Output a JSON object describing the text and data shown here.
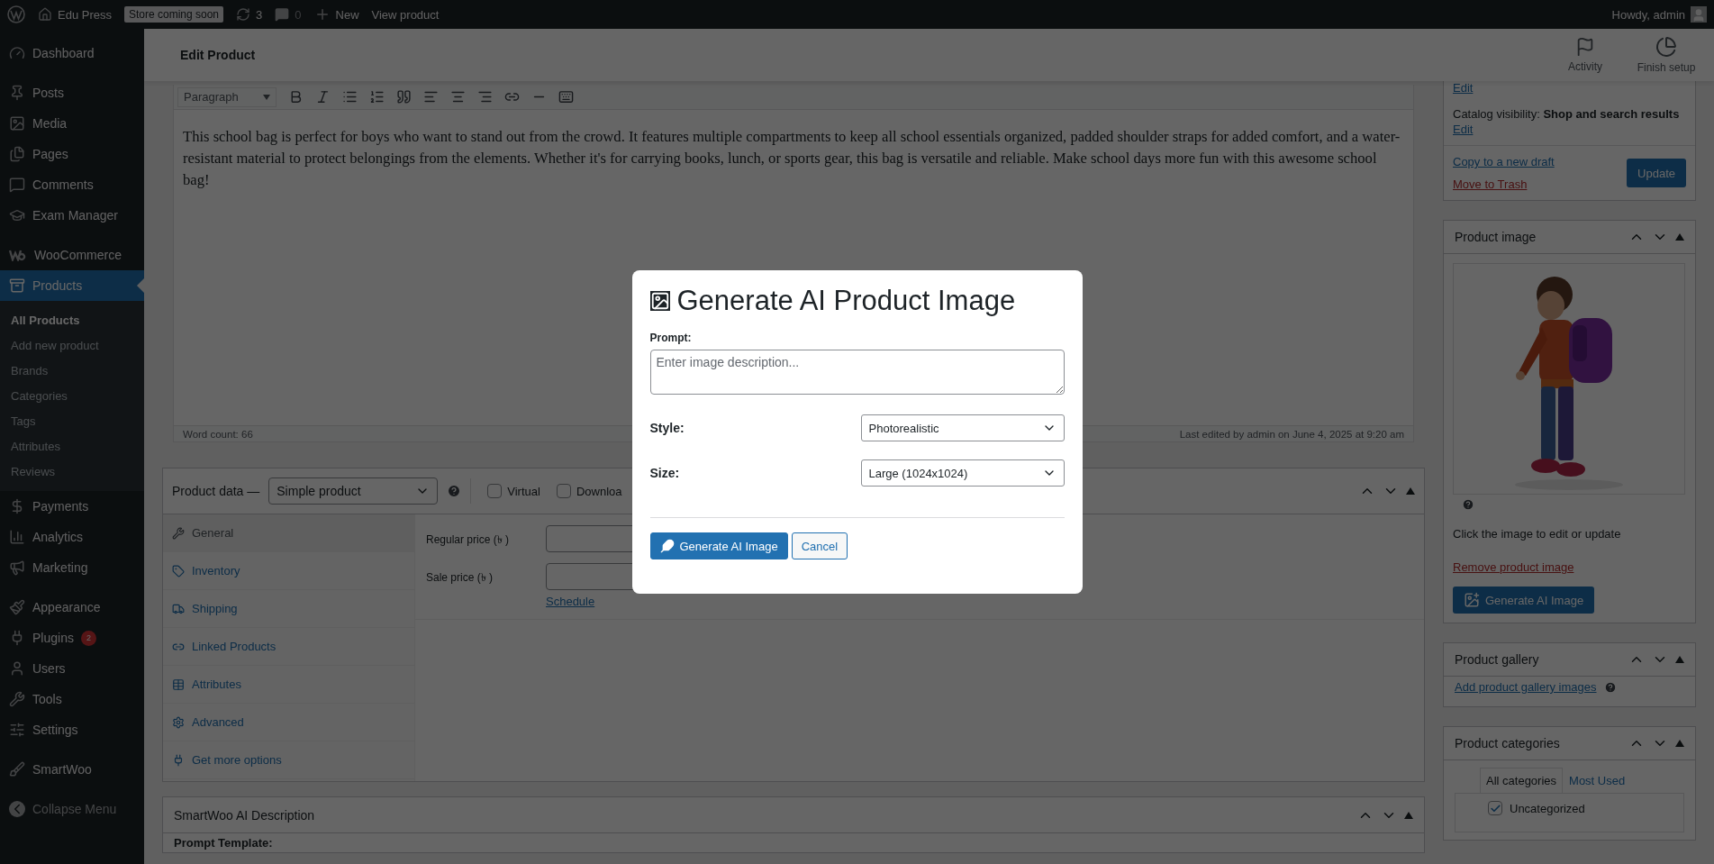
{
  "admin_bar": {
    "site": "Edu Press",
    "badge": "Store coming soon",
    "updates": "3",
    "comments": "0",
    "new": "New",
    "view": "View product",
    "greeting": "Howdy, admin"
  },
  "sidebar": {
    "groups": [
      [
        {
          "label": "Dashboard",
          "selected": false
        }
      ],
      [
        {
          "label": "Posts",
          "selected": false
        },
        {
          "label": "Media",
          "selected": false
        },
        {
          "label": "Pages",
          "selected": false
        },
        {
          "label": "Comments",
          "selected": false
        },
        {
          "label": "Exam Manager",
          "selected": false
        }
      ],
      [
        {
          "label": "WooCommerce",
          "selected": false
        },
        {
          "label": "Products",
          "selected": true,
          "children": [
            {
              "label": "All Products",
              "selected": true
            },
            {
              "label": "Add new product",
              "selected": false
            },
            {
              "label": "Brands",
              "selected": false
            },
            {
              "label": "Categories",
              "selected": false
            },
            {
              "label": "Tags",
              "selected": false
            },
            {
              "label": "Attributes",
              "selected": false
            },
            {
              "label": "Reviews",
              "selected": false
            }
          ]
        },
        {
          "label": "Payments",
          "selected": false
        },
        {
          "label": "Analytics",
          "selected": false
        },
        {
          "label": "Marketing",
          "selected": false
        }
      ],
      [
        {
          "label": "Appearance",
          "selected": false
        },
        {
          "label": "Plugins",
          "selected": false,
          "badge": "2"
        },
        {
          "label": "Users",
          "selected": false
        },
        {
          "label": "Tools",
          "selected": false
        },
        {
          "label": "Settings",
          "selected": false
        }
      ],
      [
        {
          "label": "SmartWoo",
          "selected": false
        }
      ]
    ],
    "collapse": "Collapse Menu"
  },
  "header": {
    "title": "Edit Product",
    "actions": [
      {
        "label": "Activity"
      },
      {
        "label": "Finish setup"
      }
    ]
  },
  "editor": {
    "format": "Paragraph",
    "body": "This school bag is perfect for boys who want to stand out from the crowd. It features multiple compartments to keep all school essentials organized, padded shoulder straps for added comfort, and a water-resistant material to protect belongings from the elements. Whether it's for carrying books, lunch, or sports gear, this bag is versatile and reliable. Make school days more fun with this awesome school bag!",
    "word_count": "Word count: 66",
    "last_edited": "Last edited by admin on June 4, 2025 at 9:20 am"
  },
  "product_data": {
    "title": "Product data —",
    "type": "Simple product",
    "options": [
      {
        "label": "Virtual",
        "checked": false
      },
      {
        "label": "Downloa",
        "checked": false
      }
    ],
    "tabs": [
      {
        "label": "General",
        "selected": true
      },
      {
        "label": "Inventory",
        "selected": false
      },
      {
        "label": "Shipping",
        "selected": false
      },
      {
        "label": "Linked Products",
        "selected": false
      },
      {
        "label": "Attributes",
        "selected": false
      },
      {
        "label": "Advanced",
        "selected": false
      },
      {
        "label": "Get more options",
        "selected": false
      }
    ],
    "fields": [
      {
        "label": "Regular price (৳ )"
      },
      {
        "label": "Sale price (৳ )",
        "link": "Schedule"
      }
    ]
  },
  "smartwoo": {
    "title": "SmartWoo AI Description",
    "prompt_label": "Prompt Template:"
  },
  "publish": {
    "edit_top": "Edit",
    "visibility": "Catalog visibility: **Shop and search results**",
    "edit": "Edit",
    "copy": "Copy to a new draft",
    "trash": "Move to Trash",
    "update": "Update"
  },
  "product_image": {
    "title": "Product image",
    "hint": "Click the image to edit or update",
    "remove": "Remove product image",
    "generate": "Generate AI Image"
  },
  "gallery": {
    "title": "Product gallery",
    "link": "Add product gallery images"
  },
  "categories": {
    "title": "Product categories",
    "tabs": [
      {
        "label": "All categories",
        "selected": true
      },
      {
        "label": "Most Used",
        "selected": false
      }
    ],
    "items": [
      {
        "label": "Uncategorized",
        "checked": true
      }
    ]
  },
  "modal": {
    "title": "Generate AI Product Image",
    "prompt_label": "Prompt:",
    "prompt_placeholder": "Enter image description...",
    "fields": [
      {
        "label": "Style:",
        "value": "Photorealistic"
      },
      {
        "label": "Size:",
        "value": "Large (1024x1024)"
      }
    ],
    "buttons": [
      {
        "label": "Generate AI Image",
        "kind": "primary"
      },
      {
        "label": "Cancel",
        "kind": "secondary"
      }
    ]
  }
}
